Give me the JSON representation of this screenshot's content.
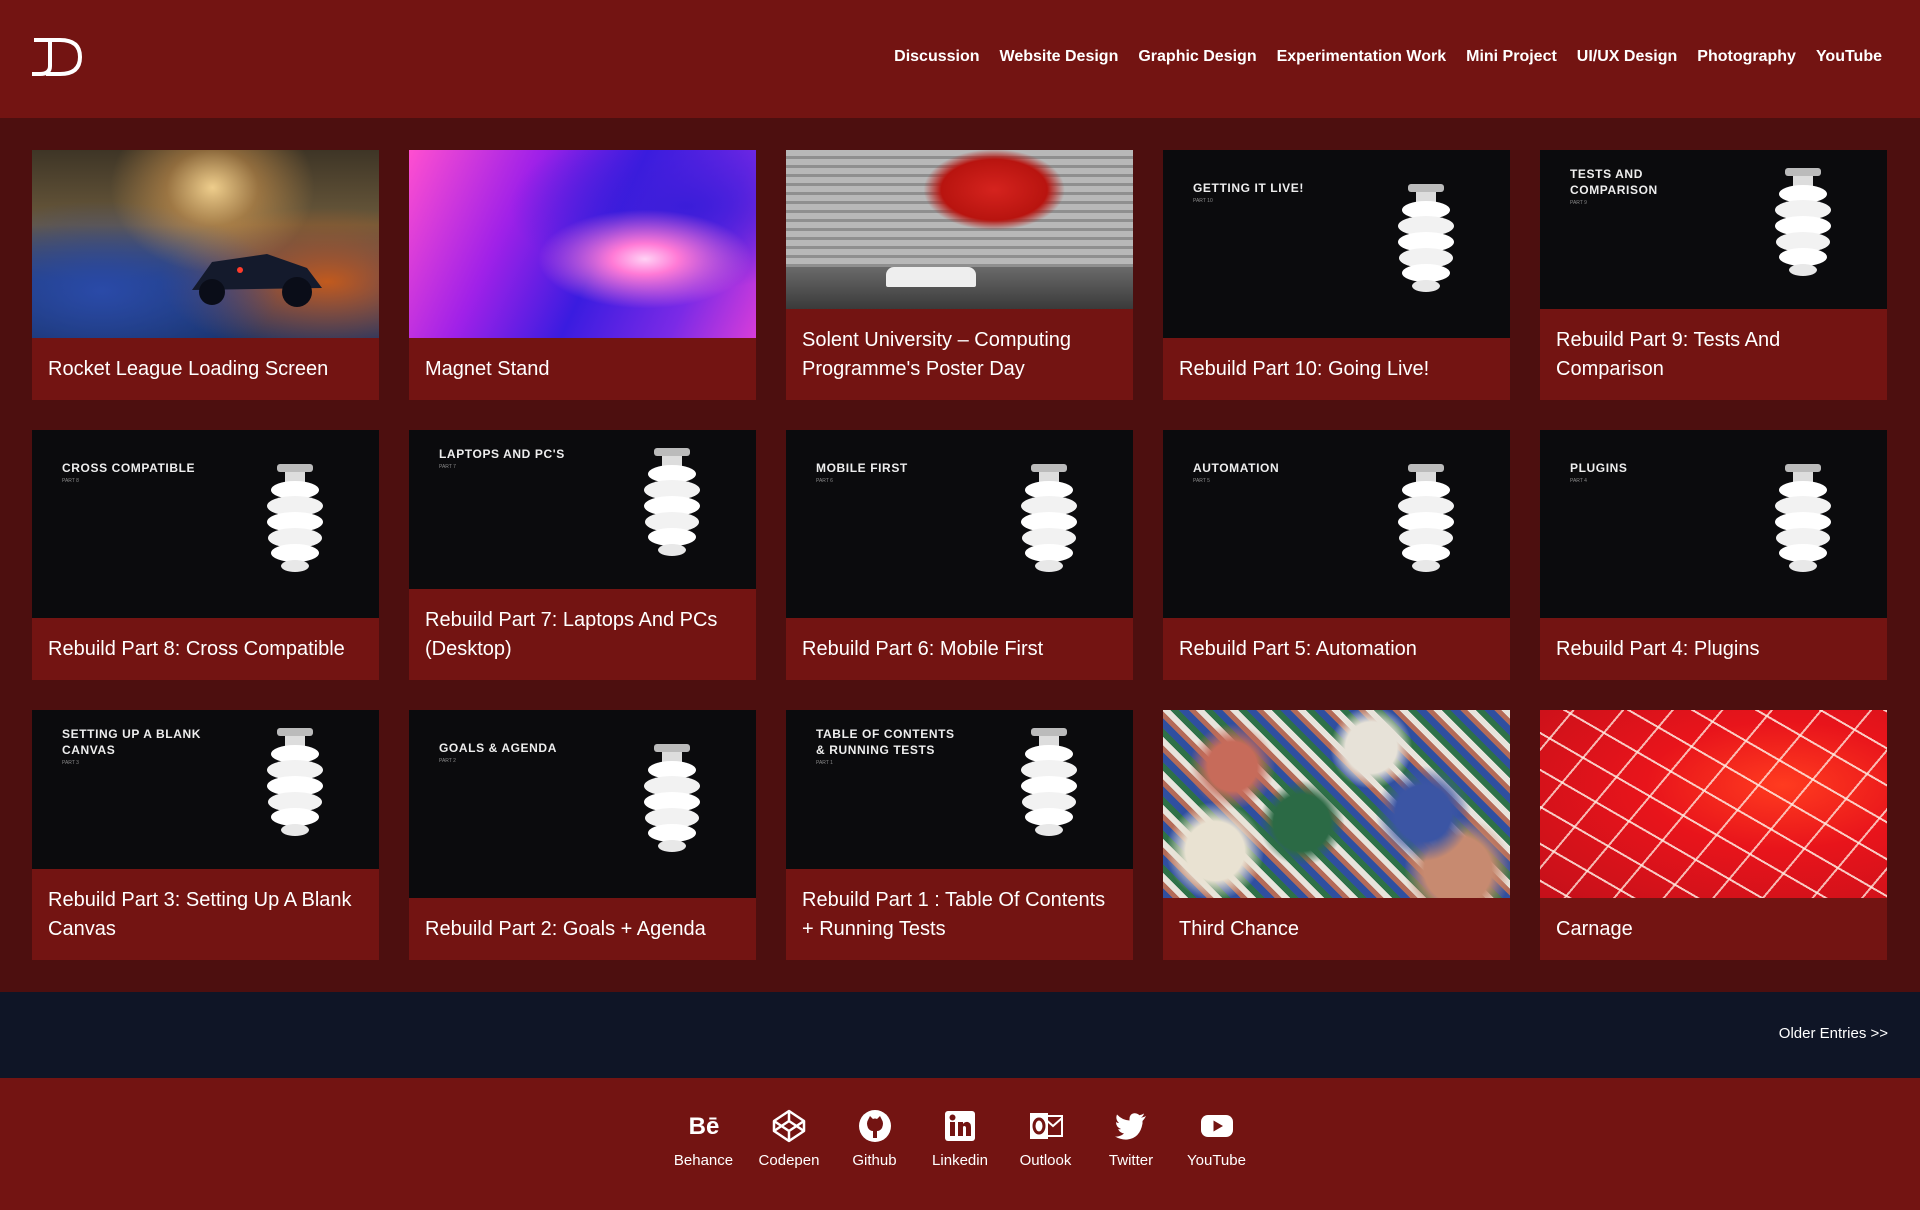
{
  "nav": {
    "items": [
      "Discussion",
      "Website Design",
      "Graphic Design",
      "Experimentation Work",
      "Mini Project",
      "UI/UX Design",
      "Photography",
      "YouTube"
    ]
  },
  "logo": {
    "icon": "jd-logo"
  },
  "posts": [
    {
      "title": "Rocket League Loading Screen",
      "thumb": "rocket-league-photo"
    },
    {
      "title": "Magnet Stand",
      "thumb": "purple-gradient-art"
    },
    {
      "title": "Solent University – Computing Programme's Poster Day",
      "thumb": "university-atrium-photo"
    },
    {
      "title": "Rebuild Part 10: Going Live!",
      "slide_title": "GETTING IT LIVE!",
      "slide_part": "PART 10",
      "thumb": "lightbulb-slide"
    },
    {
      "title": "Rebuild Part 9: Tests And Comparison",
      "slide_title": "TESTS AND COMPARISON",
      "slide_part": "PART 9",
      "thumb": "lightbulb-slide"
    },
    {
      "title": "Rebuild Part 8: Cross Compatible",
      "slide_title": "CROSS COMPATIBLE",
      "slide_part": "PART 8",
      "thumb": "lightbulb-slide"
    },
    {
      "title": "Rebuild Part 7: Laptops And PCs (Desktop)",
      "slide_title": "LAPTOPS AND PC'S",
      "slide_part": "PART 7",
      "thumb": "lightbulb-slide"
    },
    {
      "title": "Rebuild Part 6: Mobile First",
      "slide_title": "MOBILE FIRST",
      "slide_part": "PART 6",
      "thumb": "lightbulb-slide"
    },
    {
      "title": "Rebuild Part 5: Automation",
      "slide_title": "AUTOMATION",
      "slide_part": "PART 5",
      "thumb": "lightbulb-slide"
    },
    {
      "title": "Rebuild Part 4: Plugins",
      "slide_title": "PLUGINS",
      "slide_part": "PART 4",
      "thumb": "lightbulb-slide"
    },
    {
      "title": "Rebuild Part 3: Setting Up A Blank Canvas",
      "slide_title": "SETTING UP A BLANK CANVAS",
      "slide_part": "PART 3",
      "thumb": "lightbulb-slide"
    },
    {
      "title": "Rebuild Part 2: Goals + Agenda",
      "slide_title": "GOALS & AGENDA",
      "slide_part": "PART 2",
      "thumb": "lightbulb-slide"
    },
    {
      "title": "Rebuild Part 1 : Table Of Contents + Running Tests",
      "slide_title": "TABLE OF CONTENTS & RUNNING TESTS",
      "slide_part": "PART 1",
      "thumb": "lightbulb-slide"
    },
    {
      "title": "Third Chance",
      "thumb": "abstract-marbled-art"
    },
    {
      "title": "Carnage",
      "thumb": "red-cracked-art"
    }
  ],
  "pagination": {
    "older_label": "Older Entries >>"
  },
  "footer": {
    "social": [
      {
        "label": "Behance",
        "icon": "behance-icon"
      },
      {
        "label": "Codepen",
        "icon": "codepen-icon"
      },
      {
        "label": "Github",
        "icon": "github-icon"
      },
      {
        "label": "Linkedin",
        "icon": "linkedin-icon"
      },
      {
        "label": "Outlook",
        "icon": "outlook-icon"
      },
      {
        "label": "Twitter",
        "icon": "twitter-icon"
      },
      {
        "label": "YouTube",
        "icon": "youtube-icon"
      }
    ]
  },
  "colors": {
    "header_bg": "#731412",
    "page_bg": "#4d0f0f",
    "card_bg": "#731412",
    "older_bar_bg": "#0f1526"
  }
}
